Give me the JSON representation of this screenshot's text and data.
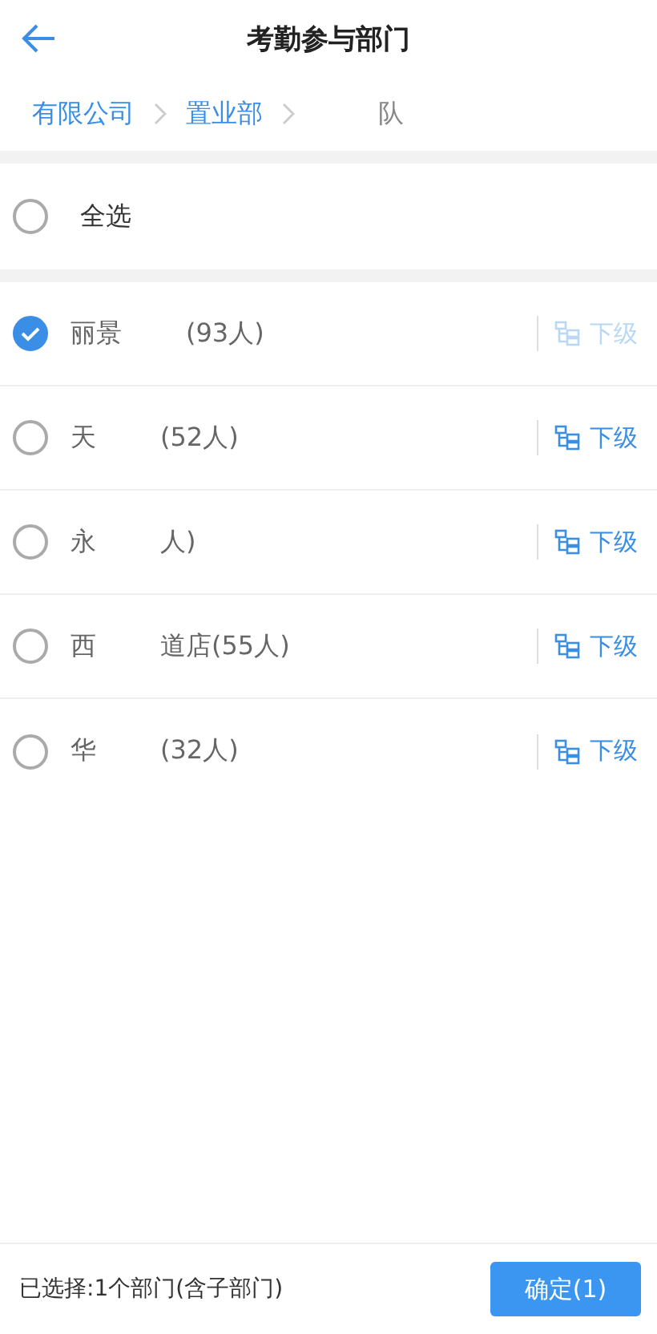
{
  "header": {
    "title": "考勤参与部门"
  },
  "breadcrumb": [
    {
      "parts": [
        "有限公司"
      ]
    },
    {
      "parts": [
        "置业部"
      ]
    },
    {
      "parts": [
        "队"
      ]
    }
  ],
  "select_all": {
    "label": "全选",
    "checked": false
  },
  "departments": [
    {
      "parts": [
        "丽景",
        "(93人)"
      ],
      "checked": true,
      "sub_label": "下级",
      "sub_disabled": true
    },
    {
      "parts": [
        "天",
        "(52人)"
      ],
      "checked": false,
      "sub_label": "下级",
      "sub_disabled": false
    },
    {
      "parts": [
        "永",
        "人)"
      ],
      "checked": false,
      "sub_label": "下级",
      "sub_disabled": false
    },
    {
      "parts": [
        "西",
        "道店(55人)"
      ],
      "checked": false,
      "sub_label": "下级",
      "sub_disabled": false
    },
    {
      "parts": [
        "华",
        "(32人)"
      ],
      "checked": false,
      "sub_label": "下级",
      "sub_disabled": false
    }
  ],
  "footer": {
    "summary": "已选择:1个部门(含子部门)",
    "confirm": "确定(1)"
  }
}
